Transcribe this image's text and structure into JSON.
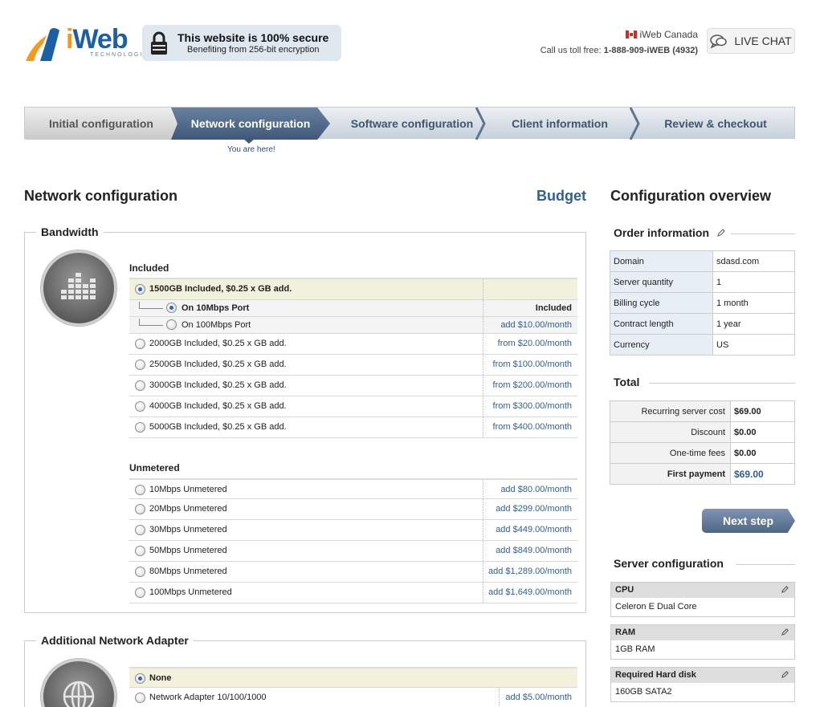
{
  "header": {
    "logo_text_i": "i",
    "logo_text_web": "Web",
    "logo_sub": "TECHNOLOGIES",
    "secure_title": "This website is 100% secure",
    "secure_sub": "Benefiting from 256-bit encryption",
    "region": "iWeb Canada",
    "phone_prefix": "Call us toll free: ",
    "phone_number": "1-888-909-iWEB (4932)",
    "live_chat": "LIVE CHAT"
  },
  "steps": [
    {
      "label": "Initial configuration",
      "state": "done"
    },
    {
      "label": "Network configuration",
      "state": "current"
    },
    {
      "label": "Software configuration",
      "state": "todo"
    },
    {
      "label": "Client information",
      "state": "todo"
    },
    {
      "label": "Review & checkout",
      "state": "todo"
    }
  ],
  "you_are_here": "You are here!",
  "main": {
    "title": "Network configuration",
    "budget": "Budget",
    "bandwidth": {
      "legend": "Bandwidth",
      "included_label": "Included",
      "included": [
        {
          "label": "1500GB Included, $0.25 x GB add.",
          "price": "",
          "selected": true
        },
        {
          "label": "On 10Mbps Port",
          "price": "Included",
          "selected": true,
          "sub": true
        },
        {
          "label": "On 100Mbps Port",
          "price": "add $10.00/month",
          "selected": false,
          "sub": true
        },
        {
          "label": "2000GB Included, $0.25 x GB add.",
          "price": "from $20.00/month",
          "selected": false
        },
        {
          "label": "2500GB Included, $0.25 x GB add.",
          "price": "from $100.00/month",
          "selected": false
        },
        {
          "label": "3000GB Included, $0.25 x GB add.",
          "price": "from $200.00/month",
          "selected": false
        },
        {
          "label": "4000GB Included, $0.25 x GB add.",
          "price": "from $300.00/month",
          "selected": false
        },
        {
          "label": "5000GB Included, $0.25 x GB add.",
          "price": "from $400.00/month",
          "selected": false
        }
      ],
      "unmetered_label": "Unmetered",
      "unmetered": [
        {
          "label": "10Mbps Unmetered",
          "price": "add $80.00/month"
        },
        {
          "label": "20Mbps Unmetered",
          "price": "add $299.00/month"
        },
        {
          "label": "30Mbps Unmetered",
          "price": "add $449.00/month"
        },
        {
          "label": "50Mbps Unmetered",
          "price": "add $849.00/month"
        },
        {
          "label": "80Mbps Unmetered",
          "price": "add $1,289.00/month"
        },
        {
          "label": "100Mbps Unmetered",
          "price": "add $1,649.00/month"
        }
      ]
    },
    "adapter": {
      "legend": "Additional Network Adapter",
      "options": [
        {
          "label": "None",
          "price": "",
          "selected": true
        },
        {
          "label": "Network Adapter 10/100/1000",
          "price": "add $5.00/month",
          "selected": false
        }
      ]
    }
  },
  "overview": {
    "title": "Configuration overview",
    "order_title": "Order information",
    "order": [
      {
        "key": "Domain",
        "value": "sdasd.com"
      },
      {
        "key": "Server quantity",
        "value": "1"
      },
      {
        "key": "Billing cycle",
        "value": "1 month"
      },
      {
        "key": "Contract length",
        "value": "1 year"
      },
      {
        "key": "Currency",
        "value": "US"
      }
    ],
    "total_title": "Total",
    "totals": [
      {
        "key": "Recurring server cost",
        "value": "$69.00"
      },
      {
        "key": "Discount",
        "value": "$0.00"
      },
      {
        "key": "One-time fees",
        "value": "$0.00"
      },
      {
        "key": "First payment",
        "value": "$69.00"
      }
    ],
    "next_step": "Next step",
    "server_title": "Server configuration",
    "server": [
      {
        "key": "CPU",
        "value": "Celeron E Dual Core"
      },
      {
        "key": "RAM",
        "value": "1GB RAM"
      },
      {
        "key": "Required Hard disk",
        "value": "160GB SATA2"
      }
    ]
  },
  "colors": {
    "accent": "#2f5f95",
    "step_active": "#4f6685",
    "selected_row": "#f1f1dc"
  },
  "icons": [
    "lock-icon",
    "flag-icon",
    "chat-icon",
    "bandwidth-icon",
    "globe-icon",
    "pencil-icon"
  ]
}
